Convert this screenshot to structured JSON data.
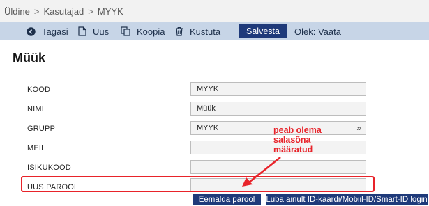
{
  "breadcrumb": [
    "Üldine",
    "Kasutajad",
    "MYYK"
  ],
  "breadcrumb_separator": ">",
  "toolbar": {
    "back": "Tagasi",
    "new": "Uus",
    "copy": "Koopia",
    "delete": "Kustuta",
    "save": "Salvesta",
    "status": "Olek: Vaata"
  },
  "page_title": "Müük",
  "fields": [
    {
      "label": "KOOD",
      "value": "MYYK"
    },
    {
      "label": "NIMI",
      "value": "Müük"
    },
    {
      "label": "GRUPP",
      "value": "MYYK",
      "has_picker": true
    },
    {
      "label": "MEIL",
      "value": ""
    },
    {
      "label": "ISIKUKOOD",
      "value": ""
    },
    {
      "label": "UUS PAROOL",
      "value": ""
    }
  ],
  "picker_glyph": "»",
  "annotation": [
    "peab olema",
    "salasõna",
    "määratud"
  ],
  "buttons": {
    "remove_password": "Eemalda parool",
    "id_card_only": "Luba ainult ID-kaardi/Mobiil-ID/Smart-ID login"
  },
  "colors": {
    "toolbar_bg": "#c7d5e7",
    "button_bg": "#1f3a7a",
    "annotation_red": "#e8232a"
  }
}
